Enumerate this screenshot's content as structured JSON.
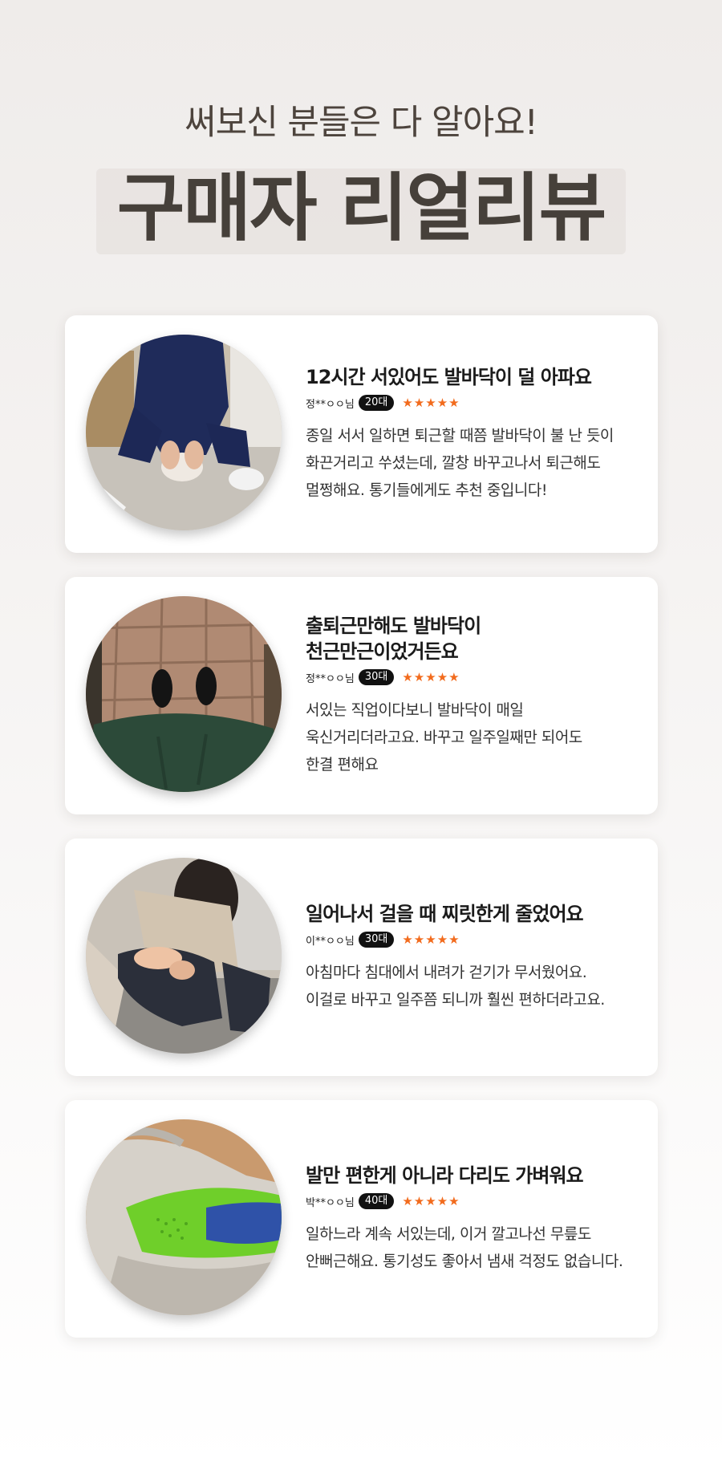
{
  "header": {
    "subtitle": "써보신 분들은 다 알아요!",
    "title": "구매자 리얼리뷰"
  },
  "reviews": [
    {
      "photo_icon": "nurse-holding-foot-photo",
      "title_lines": [
        "12시간 서있어도 발바닥이 덜 아파요"
      ],
      "name": "정**ㅇㅇ님",
      "age": "20대",
      "stars": "★★★★★",
      "body_lines": [
        "종일 서서 일하면 퇴근할 때쯤 발바닥이 불 난 듯이",
        "화끈거리고 쑤셨는데, 깔창 바꾸고나서 퇴근해도",
        "멀쩡해요. 통기들에게도 추천 중입니다!"
      ]
    },
    {
      "photo_icon": "black-shoes-on-tile-photo",
      "title_lines": [
        "출퇴근만해도 발바닥이",
        "천근만근이었거든요"
      ],
      "name": "정**ㅇㅇ님",
      "age": "30대",
      "stars": "★★★★★",
      "body_lines": [
        "서있는 직업이다보니 발바닥이 매일",
        "욱신거리더라고요. 바꾸고 일주일째만 되어도",
        "한결 편해요"
      ]
    },
    {
      "photo_icon": "woman-holding-foot-photo",
      "title_lines": [
        "일어나서 걸을 때 찌릿한게 줄었어요"
      ],
      "name": "이**ㅇㅇ님",
      "age": "30대",
      "stars": "★★★★★",
      "body_lines": [
        "아침마다 침대에서 내려가 걷기가 무서웠어요.",
        "이걸로 바꾸고 일주쯤 되니까 훨씬 편하더라고요."
      ]
    },
    {
      "photo_icon": "insole-in-sneaker-photo",
      "title_lines": [
        "발만 편한게 아니라 다리도 가벼워요"
      ],
      "name": "박**ㅇㅇ님",
      "age": "40대",
      "stars": "★★★★★",
      "body_lines": [
        "일하느라 계속 서있는데, 이거 깔고나선 무릎도",
        "안뻐근해요. 통기성도 좋아서 냄새 걱정도 없습니다."
      ]
    }
  ]
}
